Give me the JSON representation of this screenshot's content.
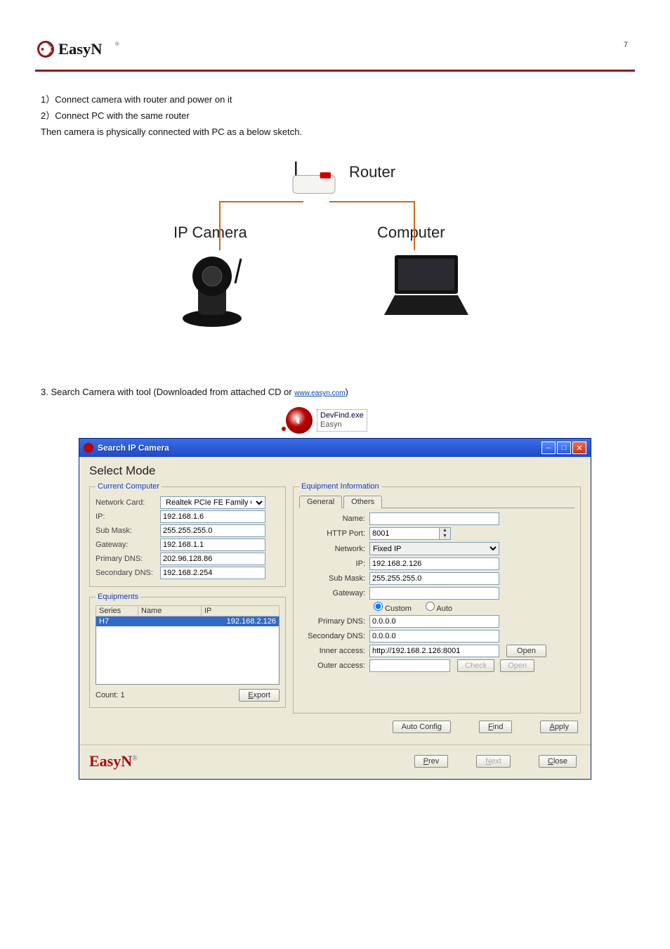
{
  "header": {
    "brand": "EasyN",
    "reg": "®",
    "page_number": "7"
  },
  "intro": {
    "line1_prefix": "1",
    "line1": "Connect camera with router and power on it",
    "line2_prefix": "2",
    "line2": "Connect PC with the same router",
    "line3": "Then camera is physically connected with PC as a below sketch."
  },
  "diagram": {
    "router": "Router",
    "ipcam": "IP Camera",
    "computer": "Computer"
  },
  "step3_prefix": "3. Search Camera with tool (Downloaded from attached CD or ",
  "step3_link_text": "www.easyn.com",
  "step3_suffix": ")",
  "devfind": {
    "line1": "DevFind.exe",
    "line2": "Easyn"
  },
  "app": {
    "title": "Search IP Camera",
    "select_mode": "Select Mode",
    "current_computer": {
      "legend": "Current Computer",
      "network_card_label": "Network Card:",
      "network_card_value": "Realtek PCIe FE Family C",
      "ip_label": "IP:",
      "ip_value": "192.168.1.6",
      "submask_label": "Sub Mask:",
      "submask_value": "255.255.255.0",
      "gateway_label": "Gateway:",
      "gateway_value": "192.168.1.1",
      "pdns_label": "Primary DNS:",
      "pdns_value": "202.96.128.86",
      "sdns_label": "Secondary DNS:",
      "sdns_value": "192.168.2.254"
    },
    "equipments": {
      "legend": "Equipments",
      "cols": {
        "series": "Series",
        "name": "Name",
        "ip": "IP"
      },
      "rows": [
        {
          "series": "H7",
          "name": "",
          "ip": "192.168.2.126"
        }
      ],
      "count_label": "Count: 1",
      "export": "Export"
    },
    "equipment_info": {
      "legend": "Equipment Information",
      "tab_general": "General",
      "tab_others": "Others",
      "name_label": "Name:",
      "name_value": "",
      "http_port_label": "HTTP Port:",
      "http_port_value": "8001",
      "network_label": "Network:",
      "network_value": "Fixed IP",
      "ip_label": "IP:",
      "ip_value": "192.168.2.126",
      "submask_label": "Sub Mask:",
      "submask_value": "255.255.255.0",
      "gateway_label": "Gateway:",
      "gateway_value": "",
      "radio_custom": "Custom",
      "radio_auto": "Auto",
      "pdns_label": "Primary DNS:",
      "pdns_value": "0.0.0.0",
      "sdns_label": "Secondary DNS:",
      "sdns_value": "0.0.0.0",
      "inner_label": "Inner access:",
      "inner_value": "http://192.168.2.126:8001",
      "outer_label": "Outer access:",
      "outer_value": "",
      "open_btn": "Open",
      "check_btn": "Check"
    },
    "buttons": {
      "auto_config": "Auto Config",
      "find": "Find",
      "apply": "Apply",
      "prev": "Prev",
      "next": "Next",
      "close": "Close"
    },
    "bottom_brand": "EasyN"
  },
  "footer_link": "www.easyn.com"
}
